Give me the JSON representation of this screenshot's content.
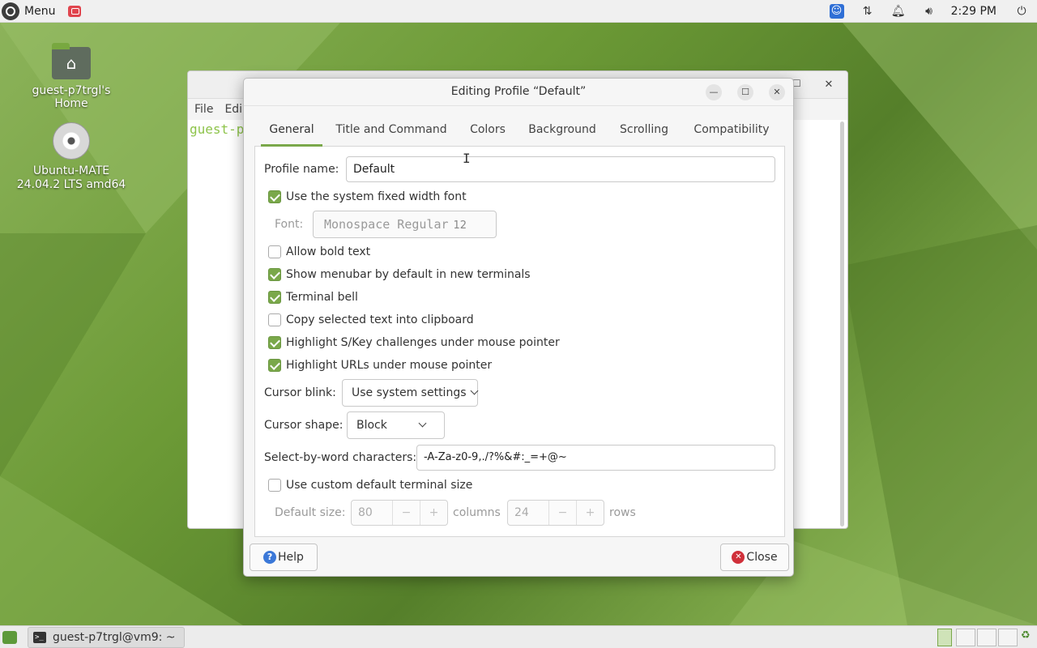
{
  "top_panel": {
    "menu_label": "Menu",
    "clock": "2:29 PM"
  },
  "desktop": {
    "icons": [
      {
        "label": "guest-p7trgl's Home",
        "icon": "home-folder-icon"
      },
      {
        "label": "Ubuntu-MATE 24.04.2 LTS amd64",
        "icon": "disc-icon"
      }
    ]
  },
  "terminal": {
    "menu": [
      "File",
      "Edi"
    ],
    "prompt_fragment": "guest-p"
  },
  "dialog": {
    "title": "Editing Profile “Default”",
    "tabs": [
      "General",
      "Title and Command",
      "Colors",
      "Background",
      "Scrolling",
      "Compatibility"
    ],
    "active_tab": "General",
    "profile_name_label": "Profile name:",
    "profile_name_value": "Default",
    "system_font_label": "Use the system fixed width font",
    "system_font_checked": true,
    "font_label": "Font:",
    "font_name": "Monospace Regular",
    "font_size": "12",
    "checkboxes": [
      {
        "label": "Allow bold text",
        "checked": false
      },
      {
        "label": "Show menubar by default in new terminals",
        "checked": true
      },
      {
        "label": "Terminal bell",
        "checked": true
      },
      {
        "label": "Copy selected text into clipboard",
        "checked": false
      },
      {
        "label": "Highlight S/Key challenges under mouse pointer",
        "checked": true
      },
      {
        "label": "Highlight URLs under mouse pointer",
        "checked": true
      }
    ],
    "cursor_blink_label": "Cursor blink:",
    "cursor_blink_value": "Use system settings",
    "cursor_shape_label": "Cursor shape:",
    "cursor_shape_value": "Block",
    "word_chars_label": "Select-by-word characters:",
    "word_chars_value": "-A-Za-z0-9,./?%&#:_=+@~",
    "custom_size_label": "Use custom default terminal size",
    "custom_size_checked": false,
    "default_size_label": "Default size:",
    "columns_value": "80",
    "columns_label": "columns",
    "rows_value": "24",
    "rows_label": "rows",
    "spin_minus": "−",
    "spin_plus": "+",
    "help_label": "Help",
    "close_label": "Close"
  },
  "bottom_panel": {
    "task_label": "guest-p7trgl@vm9: ~"
  },
  "colors": {
    "accent": "#7aa84a",
    "desktop": "#6c9a36"
  }
}
